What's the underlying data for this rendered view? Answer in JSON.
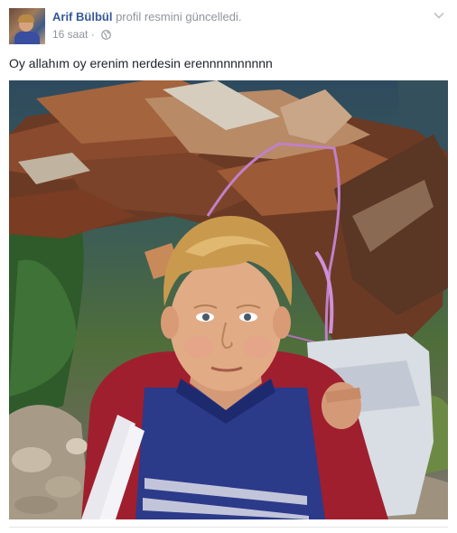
{
  "post": {
    "author": "Arif Bülbül",
    "action": "profil resmini güncelledi.",
    "time": "16 saat",
    "separator": "·",
    "privacy_icon": "globe-icon",
    "options_icon": "chevron-down-icon",
    "status_text": "Oy allahım oy erenim nerdesin erennnnnnnnnn"
  },
  "colors": {
    "author_link": "#365899",
    "secondary_text": "#90949c",
    "body_text": "#1d2129"
  }
}
